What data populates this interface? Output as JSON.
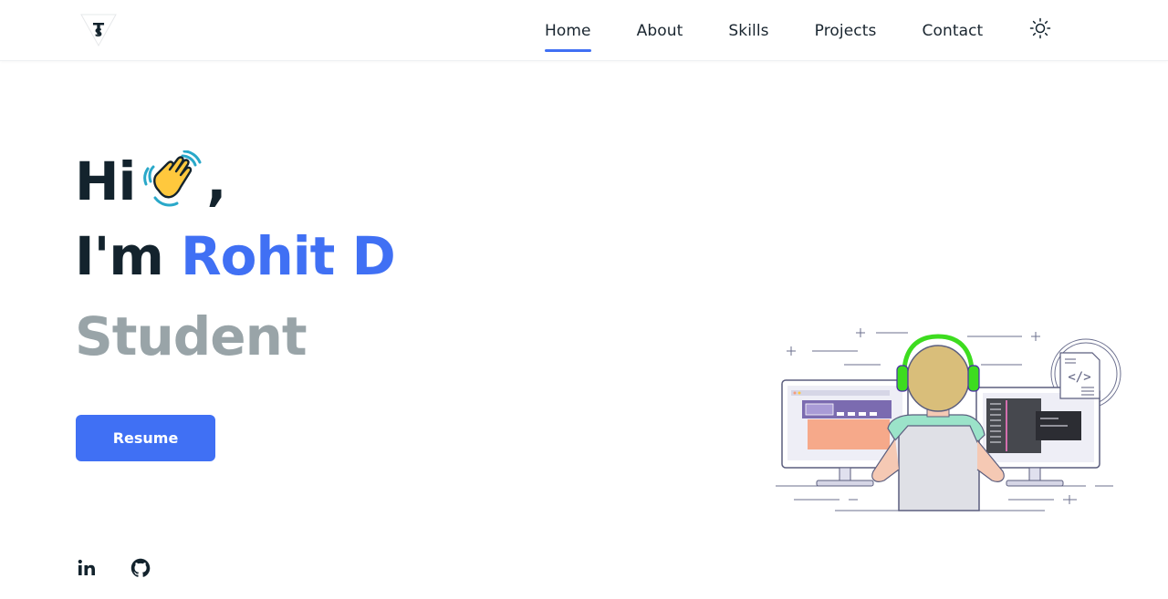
{
  "nav": {
    "logo_icon": "triangle-logo-icon",
    "items": [
      {
        "label": "Home",
        "active": true
      },
      {
        "label": "About",
        "active": false
      },
      {
        "label": "Skills",
        "active": false
      },
      {
        "label": "Projects",
        "active": false
      },
      {
        "label": "Contact",
        "active": false
      }
    ],
    "theme_icon": "sun-icon"
  },
  "hero": {
    "greeting": "Hi",
    "greeting_emoji": "waving-hand-icon",
    "greeting_suffix": ",",
    "intro_prefix": "I'm",
    "name": "Rohit D",
    "role": "Student",
    "resume_label": "Resume"
  },
  "social": [
    {
      "icon": "linkedin-icon"
    },
    {
      "icon": "github-icon"
    }
  ],
  "illustration": {
    "icon": "developer-at-computers-illustration"
  },
  "colors": {
    "accent": "#4070f4",
    "text": "#13232d",
    "muted": "#99a4a8",
    "headphones": "#3ddc1f"
  }
}
